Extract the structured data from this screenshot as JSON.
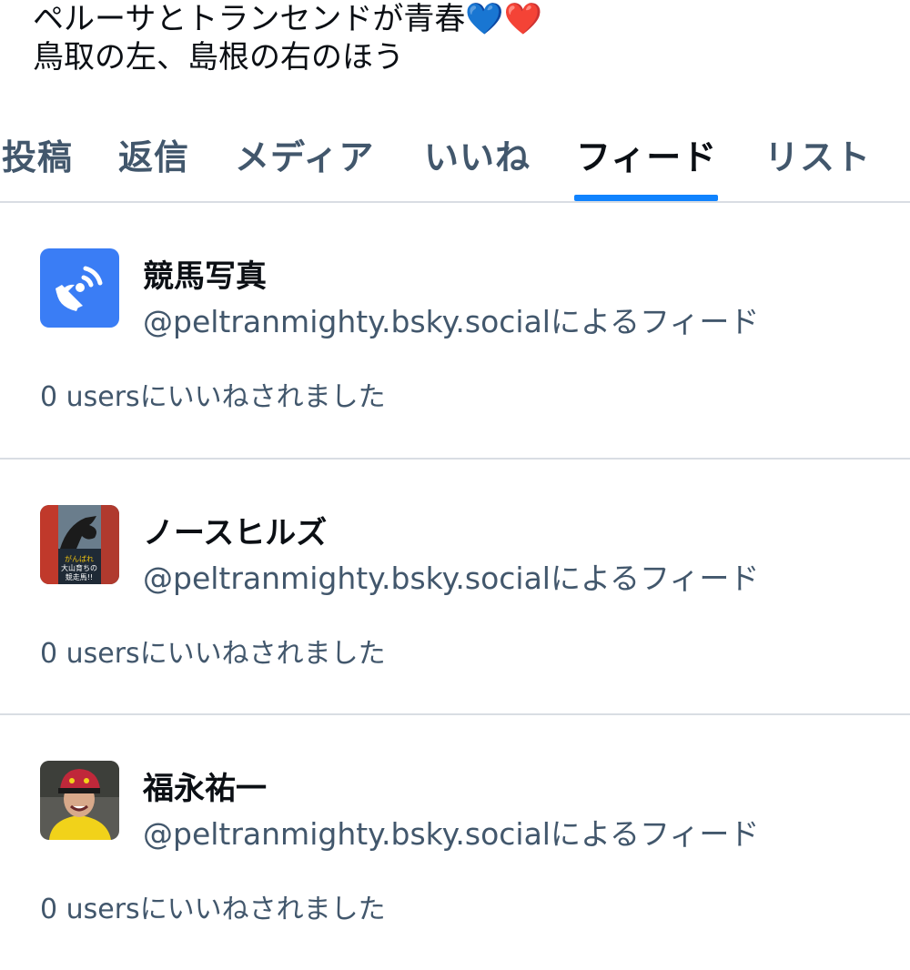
{
  "profile": {
    "bio_lines": [
      "ペルーサとトランセンドが青春💙❤️",
      "鳥取の左、島根の右のほう"
    ]
  },
  "tabs": [
    {
      "label": "投稿"
    },
    {
      "label": "返信"
    },
    {
      "label": "メディア"
    },
    {
      "label": "いいね"
    },
    {
      "label": "フィード",
      "active": true
    },
    {
      "label": "リスト"
    }
  ],
  "feeds": [
    {
      "title": "競馬写真",
      "author": "@peltranmighty.bsky.socialによるフィード",
      "likes": "0 usersにいいねされました",
      "avatar_icon": "satellite-dish-icon",
      "avatar_color": "#3a7df5"
    },
    {
      "title": "ノースヒルズ",
      "author": "@peltranmighty.bsky.socialによるフィード",
      "likes": "0 usersにいいねされました",
      "avatar_icon": "racehorse-poster-image",
      "avatar_text": "がんばれ!!\n大山育ちの\n競走馬!!"
    },
    {
      "title": "福永祐一",
      "author": "@peltranmighty.bsky.socialによるフィード",
      "likes": "0 usersにいいねされました",
      "avatar_icon": "jockey-photo-image"
    }
  ],
  "colors": {
    "accent": "#1083fe",
    "text_primary": "#0b0f14",
    "text_secondary": "#42576c",
    "divider": "#d9dde3"
  }
}
